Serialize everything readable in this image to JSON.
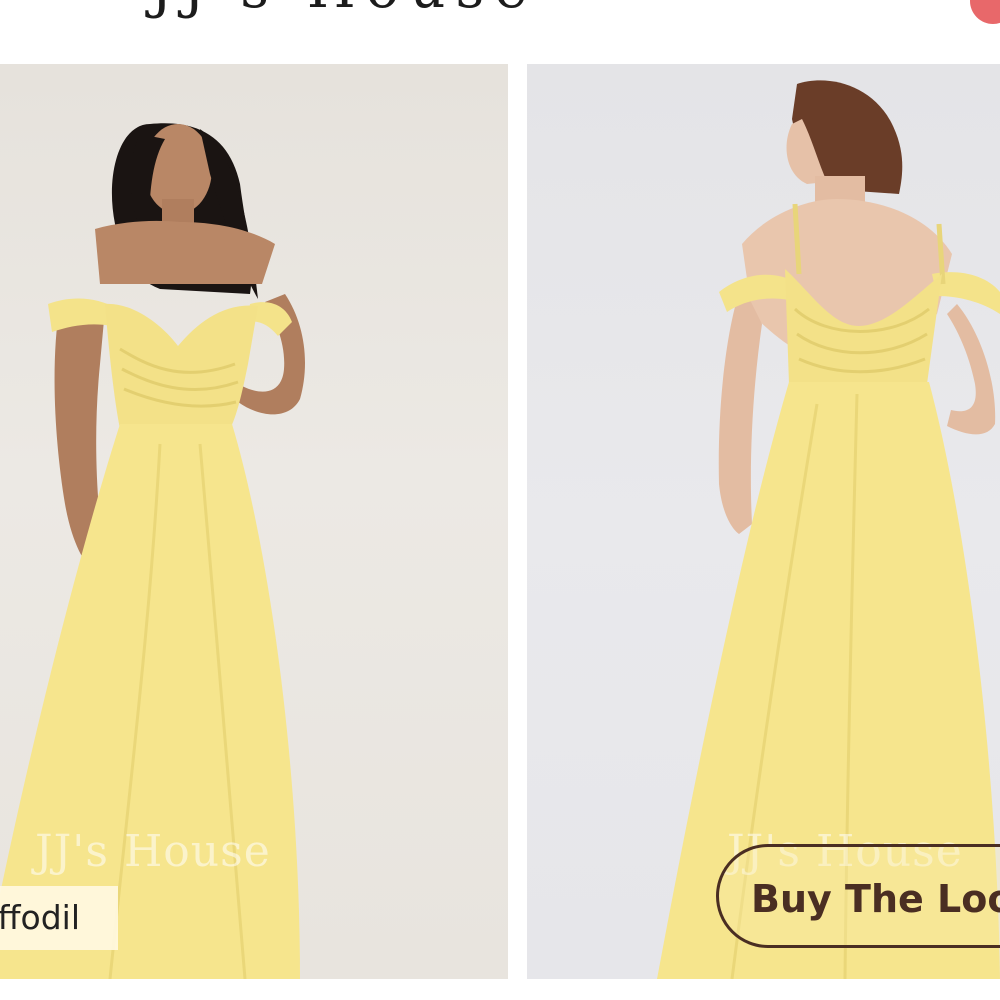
{
  "header": {
    "logo_text": "JJ's House"
  },
  "gallery": {
    "front_image": {
      "watermark": "JJ's House",
      "color_label": "Daffodil"
    },
    "back_image": {
      "watermark": "JJ's House",
      "action_label": "Buy The Look"
    }
  },
  "colors": {
    "dress": "#F6E58D",
    "badge": "#E8686A",
    "pill_border": "#4A2E22"
  }
}
